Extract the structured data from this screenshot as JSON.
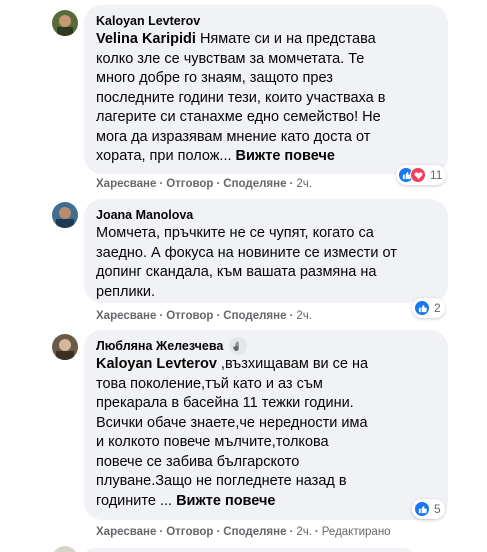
{
  "comments": [
    {
      "author": "Kaloyan Levterov",
      "mention": "Velina Karipidi",
      "text_lines": [
        " Нямате си и на представа",
        "колко зле се чувствам за момчетата. Те",
        "много добре го знаям, защото през",
        "последните години тези, които участваха в",
        "лагерите си станахме едно семейство! Не",
        "мога да изразявам мнение като доста от"
      ],
      "last_line": "хората, при полож... ",
      "see_more": "Вижте повече",
      "actions": {
        "like": "Харесване",
        "reply": "Отговор",
        "share": "Споделяне",
        "time": "2ч."
      },
      "reactions": {
        "types": [
          "like-icon",
          "love-icon"
        ],
        "count": "11"
      }
    },
    {
      "author": "Joana Manolova",
      "text_lines": [
        "Момчета, пръчките не се чупят, когато са",
        "заедно. А фокуса на новините се измести от",
        "допинг скандала, към вашата размяна на",
        "реплики."
      ],
      "actions": {
        "like": "Харесване",
        "reply": "Отговор",
        "share": "Споделяне",
        "time": "2ч."
      },
      "reactions": {
        "types": [
          "like-icon"
        ],
        "count": "2"
      }
    },
    {
      "author": "Любляна Железчева",
      "author_badge": "wave-hand-icon",
      "mention": "Kaloyan Levterov",
      "text_lines": [
        " ,възхищавам ви се на",
        "това поколение,тъй като и аз съм",
        "прекарала в басейна 11 тежки години.",
        "Всички обаче знаете,че нередности има",
        "и колкото повече мълчите,толкова",
        "повече се забива българското",
        "плуване.Защо не погледнете назад в"
      ],
      "last_line": "годините ... ",
      "see_more": "Вижте повече",
      "actions": {
        "like": "Харесване",
        "reply": "Отговор",
        "share": "Споделяне",
        "time": "2ч.",
        "edited": "Редактирано"
      },
      "reactions": {
        "types": [
          "like-icon"
        ],
        "count": "5"
      }
    }
  ],
  "colors": {
    "bubble": "#f0f2f5",
    "meta": "#65676b",
    "like": "#1877f2",
    "love": "#f33e58"
  }
}
